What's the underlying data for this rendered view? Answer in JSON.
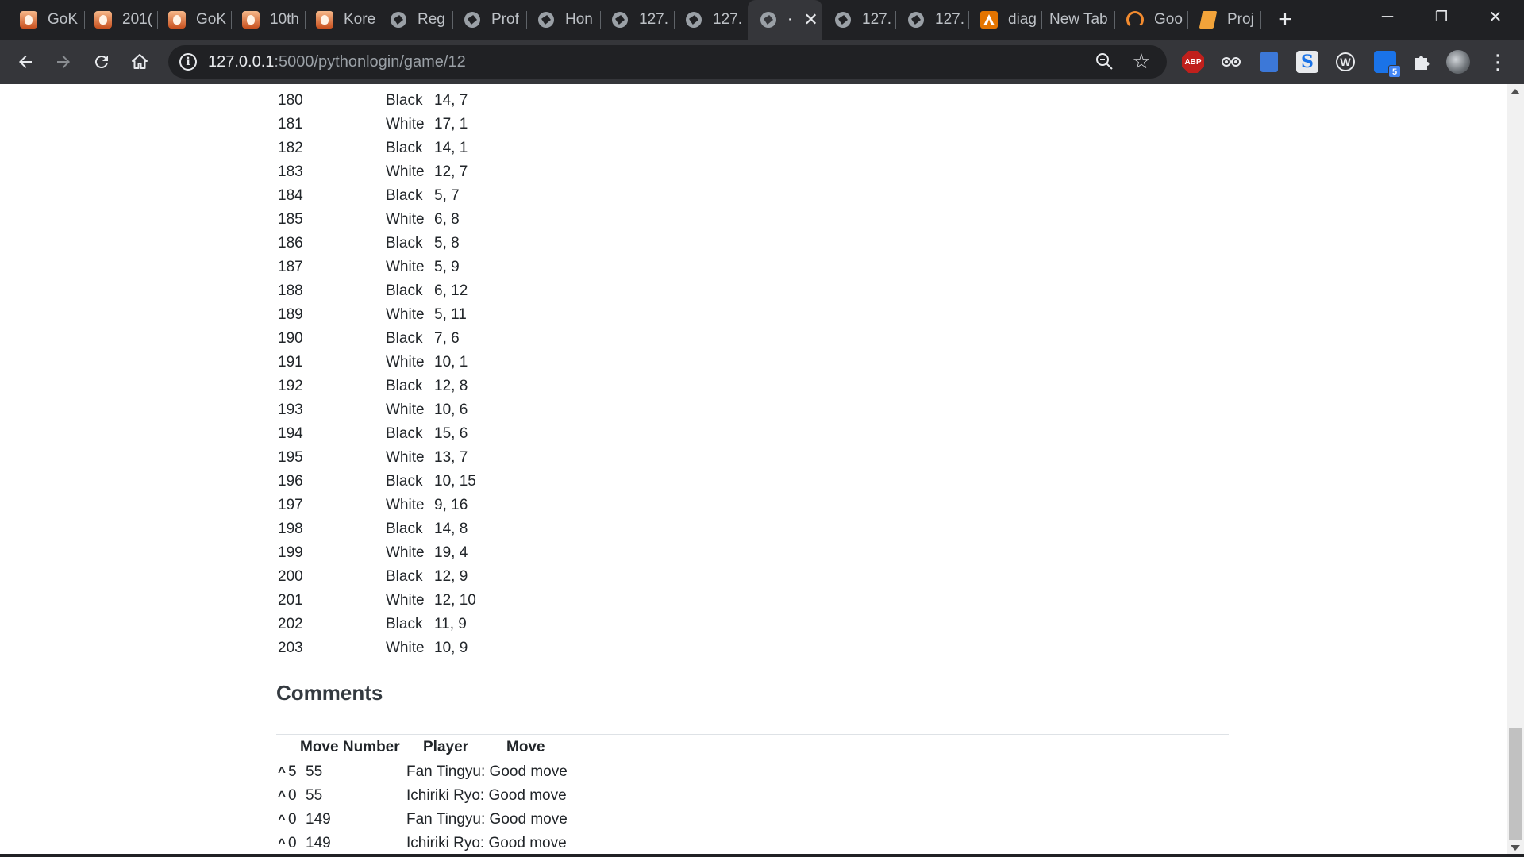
{
  "browser": {
    "tabs": [
      {
        "title": "GoK",
        "icon": "bird-favicon-icon"
      },
      {
        "title": "201(",
        "icon": "bird-favicon-icon"
      },
      {
        "title": "GoK",
        "icon": "bird-favicon-icon"
      },
      {
        "title": "10th",
        "icon": "bird-favicon-icon"
      },
      {
        "title": "Kore",
        "icon": "bird-favicon-icon"
      },
      {
        "title": "Reg",
        "icon": "globe-icon"
      },
      {
        "title": "Prof",
        "icon": "globe-icon"
      },
      {
        "title": "Hon",
        "icon": "globe-icon"
      },
      {
        "title": "127.",
        "icon": "globe-icon"
      },
      {
        "title": "127.",
        "icon": "globe-icon"
      },
      {
        "title": "·",
        "icon": "globe-icon",
        "active": true
      },
      {
        "title": "127.",
        "icon": "globe-icon"
      },
      {
        "title": "127.",
        "icon": "globe-icon"
      },
      {
        "title": "diag",
        "icon": "diagram-favicon-icon"
      },
      {
        "title": "New Tab",
        "icon": ""
      },
      {
        "title": "Goo",
        "icon": "loading-icon"
      },
      {
        "title": "Proj",
        "icon": "notebook-favicon-icon"
      }
    ],
    "window_controls": {
      "minimize": "─",
      "restore": "❐",
      "close": "✕"
    },
    "url_host": "127.0.0.1",
    "url_path": ":5000/pythonlogin/game/12",
    "extensions": {
      "abp": "ABP",
      "s": "S",
      "w": "W",
      "badge": "5"
    }
  },
  "moves": [
    {
      "num": "180",
      "color": "Black",
      "coord": "14, 7"
    },
    {
      "num": "181",
      "color": "White",
      "coord": "17, 1"
    },
    {
      "num": "182",
      "color": "Black",
      "coord": "14, 1"
    },
    {
      "num": "183",
      "color": "White",
      "coord": "12, 7"
    },
    {
      "num": "184",
      "color": "Black",
      "coord": "5, 7"
    },
    {
      "num": "185",
      "color": "White",
      "coord": "6, 8"
    },
    {
      "num": "186",
      "color": "Black",
      "coord": "5, 8"
    },
    {
      "num": "187",
      "color": "White",
      "coord": "5, 9"
    },
    {
      "num": "188",
      "color": "Black",
      "coord": "6, 12"
    },
    {
      "num": "189",
      "color": "White",
      "coord": "5, 11"
    },
    {
      "num": "190",
      "color": "Black",
      "coord": "7, 6"
    },
    {
      "num": "191",
      "color": "White",
      "coord": "10, 1"
    },
    {
      "num": "192",
      "color": "Black",
      "coord": "12, 8"
    },
    {
      "num": "193",
      "color": "White",
      "coord": "10, 6"
    },
    {
      "num": "194",
      "color": "Black",
      "coord": "15, 6"
    },
    {
      "num": "195",
      "color": "White",
      "coord": "13, 7"
    },
    {
      "num": "196",
      "color": "Black",
      "coord": "10, 15"
    },
    {
      "num": "197",
      "color": "White",
      "coord": "9, 16"
    },
    {
      "num": "198",
      "color": "Black",
      "coord": "14, 8"
    },
    {
      "num": "199",
      "color": "White",
      "coord": "19, 4"
    },
    {
      "num": "200",
      "color": "Black",
      "coord": "12, 9"
    },
    {
      "num": "201",
      "color": "White",
      "coord": "12, 10"
    },
    {
      "num": "202",
      "color": "Black",
      "coord": "11, 9"
    },
    {
      "num": "203",
      "color": "White",
      "coord": "10, 9"
    }
  ],
  "comments": {
    "heading": "Comments",
    "headers": {
      "move_number": "Move Number",
      "player": "Player",
      "move": "Move"
    },
    "rows": [
      {
        "caret": "^",
        "votes": "5",
        "move": "55",
        "text": "Fan Tingyu: Good move"
      },
      {
        "caret": "^",
        "votes": "0",
        "move": "55",
        "text": "Ichiriki Ryo: Good move"
      },
      {
        "caret": "^",
        "votes": "0",
        "move": "149",
        "text": "Fan Tingyu: Good move"
      },
      {
        "caret": "^",
        "votes": "0",
        "move": "149",
        "text": "Ichiriki Ryo: Good move"
      }
    ]
  }
}
